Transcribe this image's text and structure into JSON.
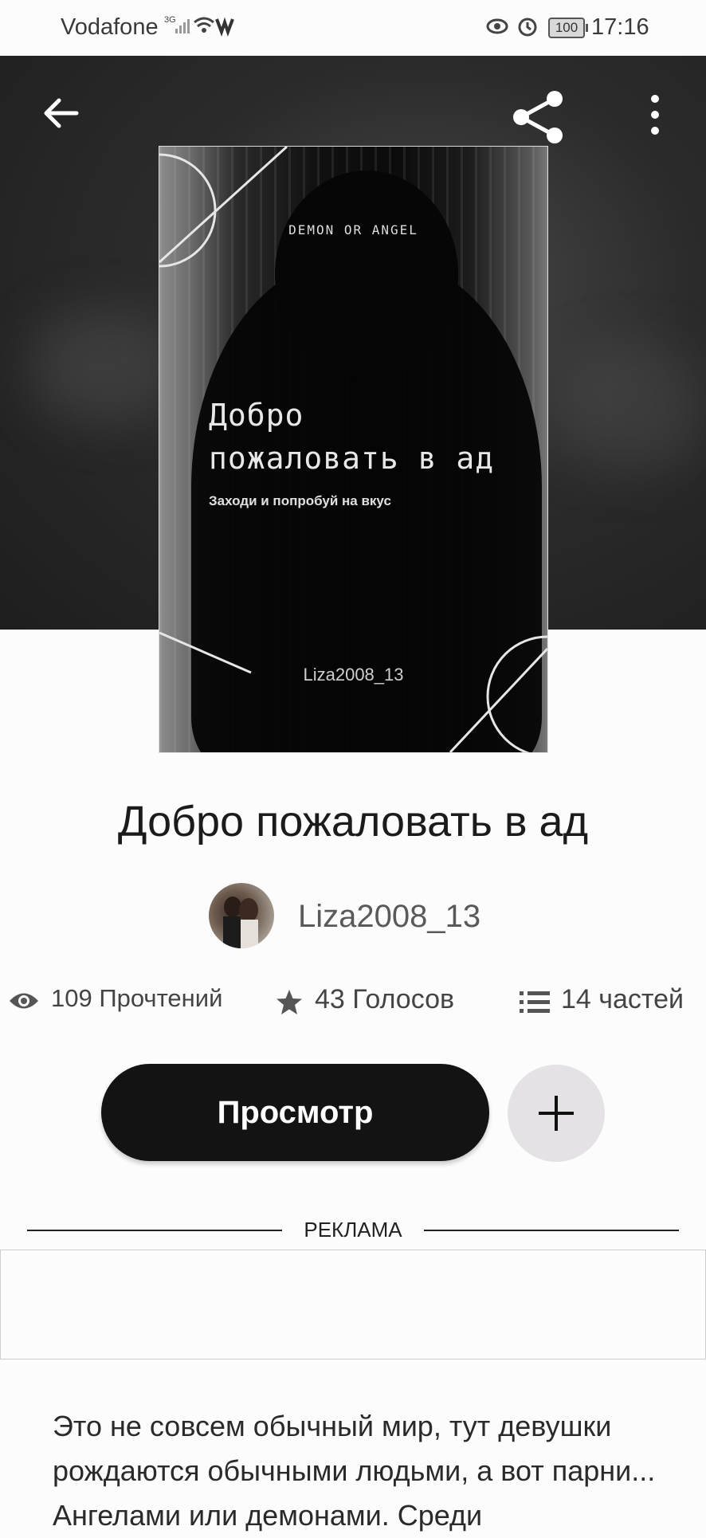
{
  "status_bar": {
    "carrier": "Vodafone",
    "network": "3G",
    "battery": "100",
    "time": "17:16"
  },
  "book": {
    "title": "Добро пожаловать в ад",
    "cover": {
      "series": "DEMON OR ANGEL",
      "title_line1": "Добро",
      "title_line2": "пожаловать в ад",
      "subtitle": "Заходи и попробуй на вкус",
      "author": "Liza2008_13"
    },
    "author": "Liza2008_13",
    "stats": {
      "reads": "109 Прочтений",
      "votes": "43 Голосов",
      "parts": "14 частей"
    },
    "description": "Это не совсем обычный мир, тут девушки рождаются обычными людьми, а вот парни... Ангелами или демонами. Среди"
  },
  "actions": {
    "view_label": "Просмотр",
    "add_label": "+"
  },
  "ad": {
    "label": "РЕКЛАМА"
  },
  "icons": {
    "back": "arrow-left-icon",
    "share": "share-icon",
    "more": "more-vertical-icon",
    "reads": "eye-icon",
    "votes": "star-icon",
    "parts": "list-icon"
  },
  "colors": {
    "primary_button": "#141314",
    "secondary_button": "#e4e2e5",
    "hero_background": "#2b2b2b"
  }
}
